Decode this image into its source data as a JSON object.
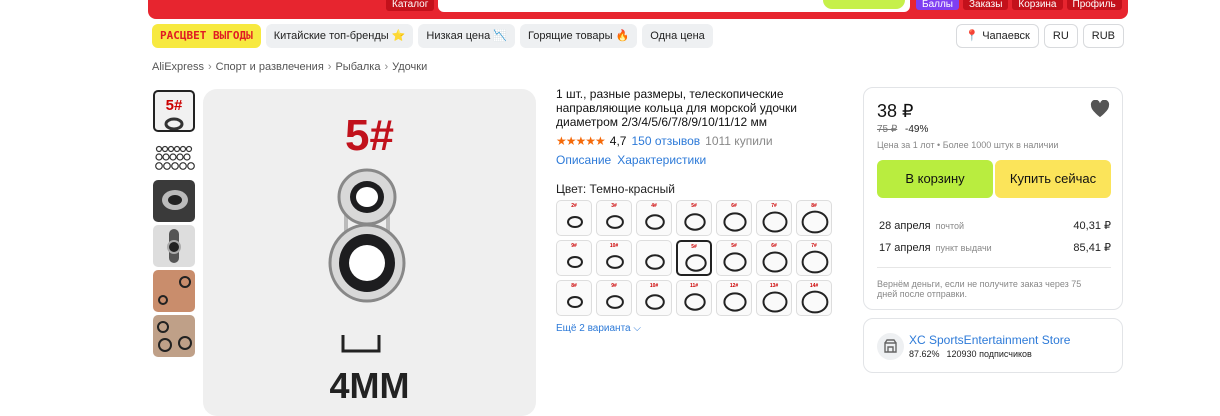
{
  "header": {
    "catalog_label": "Каталог",
    "links": [
      "Баллы",
      "Заказы",
      "Корзина",
      "Профиль"
    ]
  },
  "promo_chips": [
    "РАСЦВЕТ ВЫГОДЫ",
    "Китайские топ-бренды ⭐",
    "Низкая цена 📉",
    "Горящие товары 🔥",
    "Одна цена"
  ],
  "location_chips": {
    "city": "Чапаевск",
    "language": "RU",
    "currency": "RUB"
  },
  "breadcrumb": [
    "AliExpress",
    "Спорт и развлечения",
    "Рыбалка",
    "Удочки"
  ],
  "gallery": {
    "main_label_top": "5#",
    "main_label_bottom": "4MM",
    "thumb_label": "5#"
  },
  "product": {
    "title": "1 шт., разные размеры, телескопические направляющие кольца для морской удочки диаметром 2/3/4/5/6/7/8/9/10/11/12 мм",
    "stars": "★★★★★",
    "rating": "4,7",
    "reviews": "150 отзывов",
    "bought": "1011 купили",
    "tabs": [
      "Описание",
      "Характеристики"
    ],
    "color_label": "Цвет: Темно-красный",
    "swatch_labels": [
      "2#",
      "3#",
      "4#",
      "5#",
      "6#",
      "7#",
      "8#",
      "9#",
      "10#",
      "",
      "5#",
      "5#",
      "6#",
      "7#",
      "8#",
      "9#",
      "10#",
      "11#",
      "12#",
      "13#",
      "14#"
    ],
    "selected_swatch_index": 10,
    "more_variants": "Ещё 2 варианта"
  },
  "buybox": {
    "price": "38 ₽",
    "old_price": "75 ₽",
    "discount": "-49%",
    "price_note": "Цена за 1 лот • Более 1000 штук в наличии",
    "cart_label": "В корзину",
    "buy_label": "Купить сейчас",
    "deliveries": [
      {
        "date": "28 апреля",
        "type": "почтой",
        "price": "40,31 ₽"
      },
      {
        "date": "17 апреля",
        "type": "пункт выдачи",
        "price": "85,41 ₽"
      }
    ],
    "refund_note": "Вернём деньги, если не получите заказ через 75 дней после отправки."
  },
  "store": {
    "name": "XC SportsEntertainment Store",
    "rating": "87.62%",
    "subscribers": "120930 подписчиков"
  },
  "colors": {
    "accent_red": "#e7252f",
    "cart_green": "#b9ed3f",
    "buy_yellow": "#fbe45a",
    "link_blue": "#2d7ad8",
    "star_orange": "#f56a0a"
  }
}
